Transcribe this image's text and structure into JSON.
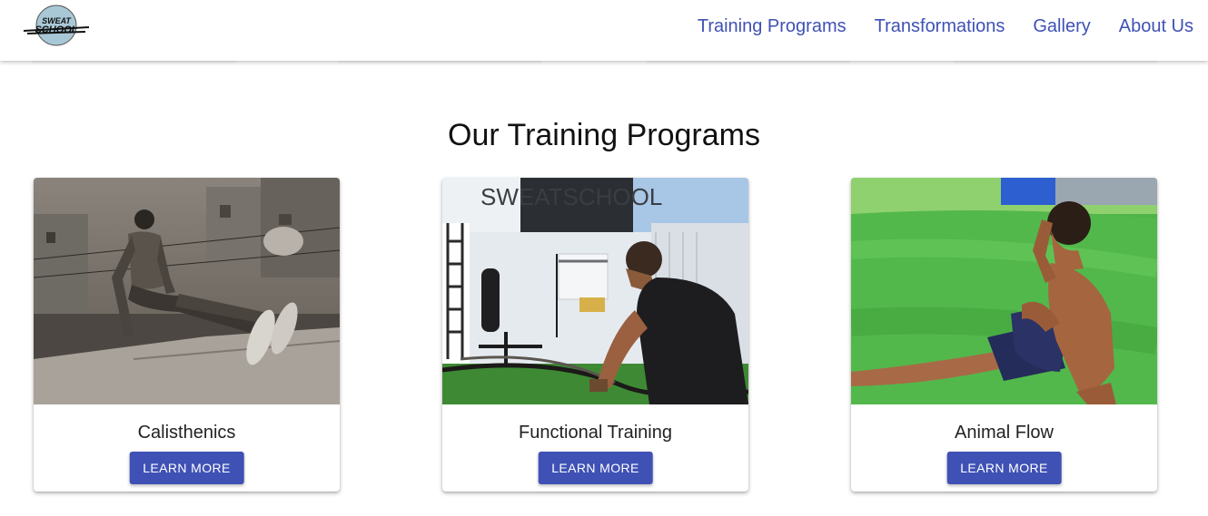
{
  "header": {
    "logo_text": "SWEAT SCHOOL",
    "nav": [
      {
        "label": "Training Programs"
      },
      {
        "label": "Transformations"
      },
      {
        "label": "Gallery"
      },
      {
        "label": "About Us"
      }
    ]
  },
  "main": {
    "title": "Our Training Programs",
    "cards": [
      {
        "title": "Calisthenics",
        "button": "LEARN MORE",
        "image": "rooftop-calisthenics-photo"
      },
      {
        "title": "Functional Training",
        "button": "LEARN MORE",
        "image": "battle-ropes-gym-photo",
        "sign_text": "SWEATSCHOOL"
      },
      {
        "title": "Animal Flow",
        "button": "LEARN MORE",
        "image": "turf-animal-flow-photo"
      }
    ]
  },
  "colors": {
    "accent": "#3f51b5",
    "text": "#222222"
  }
}
